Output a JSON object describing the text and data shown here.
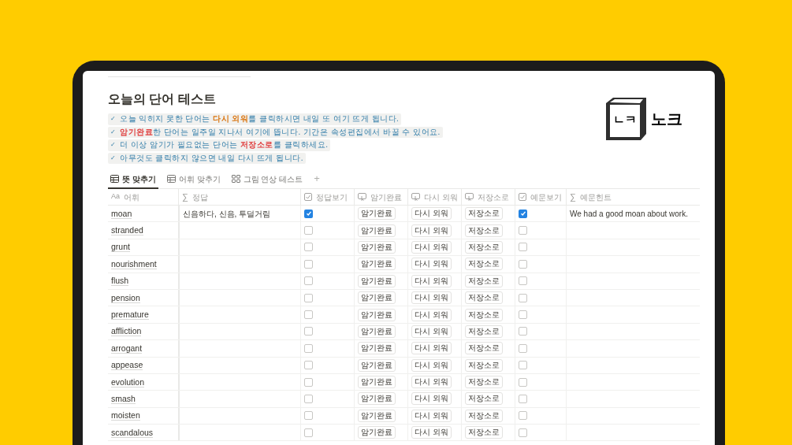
{
  "page": {
    "title": "오늘의 단어 테스트"
  },
  "logo": {
    "mark": "ㄴㅋ",
    "text": "노크"
  },
  "callouts": [
    {
      "check": "✓",
      "segments": [
        {
          "text": "오늘 익히지 못한 단어는 "
        },
        {
          "text": "다시 외워",
          "color": "#d9730d"
        },
        {
          "text": "를 클릭하시면 내일 또 여기 뜨게 됩니다."
        }
      ]
    },
    {
      "check": "✓",
      "segments": [
        {
          "text": "암기완료",
          "color": "#e03e3e"
        },
        {
          "text": "한 단어는 일주일 지나서 여기에 뜹니다. 기간은 속성편집에서 바꿀 수 있어요."
        }
      ]
    },
    {
      "check": "✓",
      "segments": [
        {
          "text": "더 이상 암기가 필요없는 단어는 "
        },
        {
          "text": "저장소로",
          "color": "#e03e3e"
        },
        {
          "text": "를 클릭하세요."
        }
      ]
    },
    {
      "check": "✓",
      "segments": [
        {
          "text": "아무것도 클릭하지 않으면 내일 다시 뜨게 됩니다."
        }
      ]
    }
  ],
  "tabs": [
    {
      "label": "뜻 맞추기",
      "kind": "table",
      "selected": true
    },
    {
      "label": "어휘 맞추기",
      "kind": "table",
      "selected": false
    },
    {
      "label": "그림 연상 테스트",
      "kind": "gallery",
      "selected": false
    }
  ],
  "add_tab": "+",
  "columns": [
    {
      "label": "어휘",
      "kind": "title",
      "glyph": "Aa"
    },
    {
      "label": "정답",
      "kind": "formula",
      "glyph": "∑"
    },
    {
      "label": "정답보기",
      "kind": "checkbox"
    },
    {
      "label": "암기완료",
      "kind": "button"
    },
    {
      "label": "다시 외워",
      "kind": "button"
    },
    {
      "label": "저장소로",
      "kind": "button"
    },
    {
      "label": "예문보기",
      "kind": "checkbox"
    },
    {
      "label": "예문힌트",
      "kind": "formula",
      "glyph": "∑"
    }
  ],
  "rows": [
    {
      "word": "moan",
      "answer": "신음하다, 신음, 투덜거림",
      "show_answer": true,
      "buttons": [
        "암기완료",
        "다시 외워",
        "저장소로"
      ],
      "show_example": true,
      "hint": "We had a good moan about work."
    },
    {
      "word": "stranded",
      "show_answer": false,
      "buttons": [
        "암기완료",
        "다시 외워",
        "저장소로"
      ],
      "show_example": false
    },
    {
      "word": "grunt",
      "show_answer": false,
      "buttons": [
        "암기완료",
        "다시 외워",
        "저장소로"
      ],
      "show_example": false
    },
    {
      "word": "nourishment",
      "show_answer": false,
      "buttons": [
        "암기완료",
        "다시 외워",
        "저장소로"
      ],
      "show_example": false
    },
    {
      "word": "flush",
      "show_answer": false,
      "buttons": [
        "암기완료",
        "다시 외워",
        "저장소로"
      ],
      "show_example": false
    },
    {
      "word": "pension",
      "show_answer": false,
      "buttons": [
        "암기완료",
        "다시 외워",
        "저장소로"
      ],
      "show_example": false
    },
    {
      "word": "premature",
      "show_answer": false,
      "buttons": [
        "암기완료",
        "다시 외워",
        "저장소로"
      ],
      "show_example": false
    },
    {
      "word": "affliction",
      "show_answer": false,
      "buttons": [
        "암기완료",
        "다시 외워",
        "저장소로"
      ],
      "show_example": false
    },
    {
      "word": "arrogant",
      "show_answer": false,
      "buttons": [
        "암기완료",
        "다시 외워",
        "저장소로"
      ],
      "show_example": false
    },
    {
      "word": "appease",
      "show_answer": false,
      "buttons": [
        "암기완료",
        "다시 외워",
        "저장소로"
      ],
      "show_example": false
    },
    {
      "word": "evolution",
      "show_answer": false,
      "buttons": [
        "암기완료",
        "다시 외워",
        "저장소로"
      ],
      "show_example": false
    },
    {
      "word": "smash",
      "show_answer": false,
      "buttons": [
        "암기완료",
        "다시 외워",
        "저장소로"
      ],
      "show_example": false
    },
    {
      "word": "moisten",
      "show_answer": false,
      "buttons": [
        "암기완료",
        "다시 외워",
        "저장소로"
      ],
      "show_example": false
    },
    {
      "word": "scandalous",
      "show_answer": false,
      "buttons": [
        "암기완료",
        "다시 외워",
        "저장소로"
      ],
      "show_example": false
    }
  ]
}
